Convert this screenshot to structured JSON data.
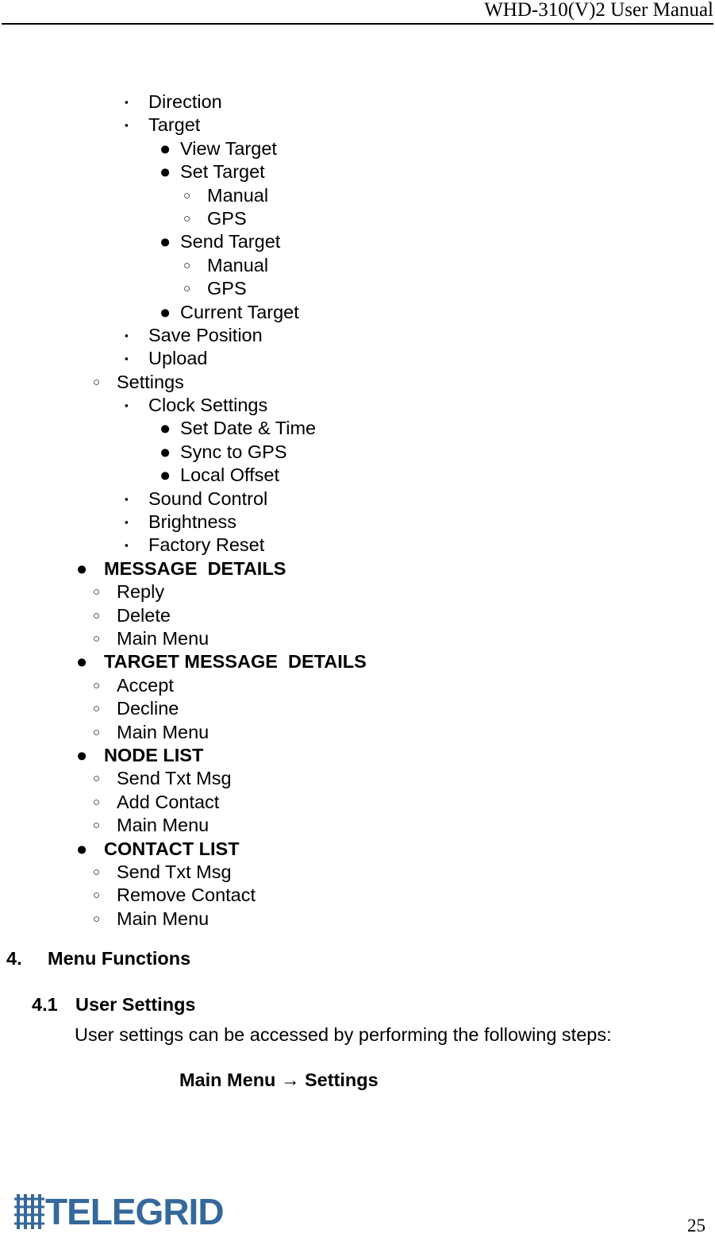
{
  "header": {
    "title": "WHD-310(V)2 User Manual"
  },
  "outline": [
    {
      "level": 3,
      "bullet": "square",
      "text": "Direction",
      "bold": false
    },
    {
      "level": 3,
      "bullet": "square",
      "text": "Target",
      "bold": false
    },
    {
      "level": 4,
      "bullet": "disc",
      "text": "View Target",
      "bold": false
    },
    {
      "level": 4,
      "bullet": "disc",
      "text": "Set Target",
      "bold": false
    },
    {
      "level": 5,
      "bullet": "circle",
      "text": "Manual",
      "bold": false
    },
    {
      "level": 5,
      "bullet": "circle",
      "text": "GPS",
      "bold": false
    },
    {
      "level": 4,
      "bullet": "disc",
      "text": "Send Target",
      "bold": false
    },
    {
      "level": 5,
      "bullet": "circle",
      "text": "Manual",
      "bold": false
    },
    {
      "level": 5,
      "bullet": "circle",
      "text": "GPS",
      "bold": false
    },
    {
      "level": 4,
      "bullet": "disc",
      "text": "Current Target",
      "bold": false
    },
    {
      "level": 3,
      "bullet": "square",
      "text": "Save Position",
      "bold": false
    },
    {
      "level": 3,
      "bullet": "square",
      "text": "Upload",
      "bold": false
    },
    {
      "level": 2,
      "bullet": "circle",
      "text": "Settings",
      "bold": false
    },
    {
      "level": 3,
      "bullet": "square",
      "text": "Clock Settings",
      "bold": false
    },
    {
      "level": 4,
      "bullet": "disc",
      "text": "Set Date & Time",
      "bold": false
    },
    {
      "level": 4,
      "bullet": "disc",
      "text": "Sync to GPS",
      "bold": false
    },
    {
      "level": 4,
      "bullet": "disc",
      "text": "Local Offset",
      "bold": false
    },
    {
      "level": 3,
      "bullet": "square",
      "text": "Sound Control",
      "bold": false
    },
    {
      "level": 3,
      "bullet": "square",
      "text": "Brightness",
      "bold": false
    },
    {
      "level": 3,
      "bullet": "square",
      "text": "Factory Reset",
      "bold": false
    },
    {
      "level": 1,
      "bullet": "disc",
      "text": "MESSAGE  DETAILS",
      "bold": true
    },
    {
      "level": 2,
      "bullet": "circle",
      "text": "Reply",
      "bold": false
    },
    {
      "level": 2,
      "bullet": "circle",
      "text": "Delete",
      "bold": false
    },
    {
      "level": 2,
      "bullet": "circle",
      "text": "Main Menu",
      "bold": false
    },
    {
      "level": 1,
      "bullet": "disc",
      "text": "TARGET MESSAGE  DETAILS",
      "bold": true
    },
    {
      "level": 2,
      "bullet": "circle",
      "text": "Accept",
      "bold": false
    },
    {
      "level": 2,
      "bullet": "circle",
      "text": "Decline",
      "bold": false
    },
    {
      "level": 2,
      "bullet": "circle",
      "text": "Main Menu",
      "bold": false
    },
    {
      "level": 1,
      "bullet": "disc",
      "text": "NODE LIST",
      "bold": true
    },
    {
      "level": 2,
      "bullet": "circle",
      "text": "Send Txt Msg",
      "bold": false
    },
    {
      "level": 2,
      "bullet": "circle",
      "text": "Add Contact",
      "bold": false
    },
    {
      "level": 2,
      "bullet": "circle",
      "text": "Main Menu",
      "bold": false
    },
    {
      "level": 1,
      "bullet": "disc",
      "text": "CONTACT LIST",
      "bold": true
    },
    {
      "level": 2,
      "bullet": "circle",
      "text": "Send Txt Msg",
      "bold": false
    },
    {
      "level": 2,
      "bullet": "circle",
      "text": "Remove Contact",
      "bold": false
    },
    {
      "level": 2,
      "bullet": "circle",
      "text": "Main Menu",
      "bold": false
    }
  ],
  "section": {
    "number": "4.",
    "title": "Menu Functions"
  },
  "subsection": {
    "number": "4.1",
    "title": "User Settings"
  },
  "paragraph": "User settings can be accessed by performing the following steps:",
  "navigation_path": "Main Menu → Settings",
  "footer": {
    "logo_text": "TELEGRID",
    "logo_color": "#35689b",
    "page_number": "25"
  }
}
